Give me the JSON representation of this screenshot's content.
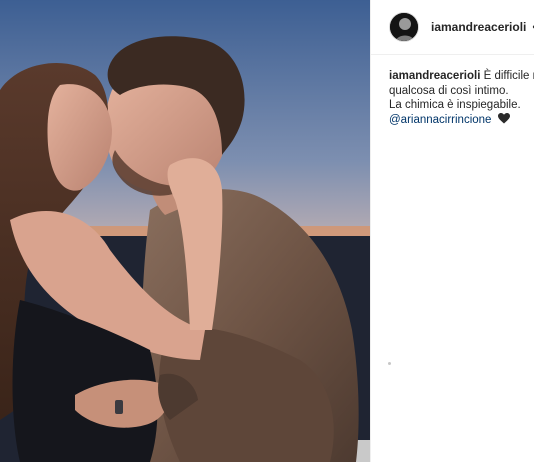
{
  "post": {
    "username": "iamandreacerioli",
    "separator": "•",
    "verified_icon": "verified-badge-icon",
    "image_alt": "Couple kissing at sunset",
    "caption": {
      "username": "iamandreacerioli",
      "line1": "È difficile rac",
      "line2": "qualcosa di così intimo.",
      "line3": "La chimica è inspiegabile.",
      "mention": "@ariannacirrincione",
      "emoji_icon": "black-heart-icon"
    }
  },
  "colors": {
    "link": "#003569",
    "verified": "#3897f0",
    "border": "#efefef",
    "sunset": "#f19a4c",
    "sky": "#4a6a99"
  }
}
